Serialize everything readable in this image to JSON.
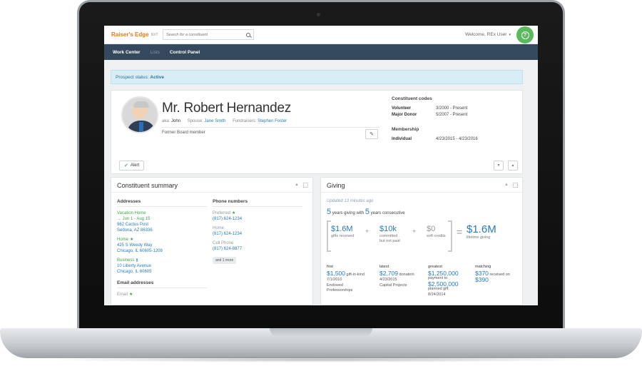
{
  "app": {
    "logo": "Raiser's Edge",
    "logo_suffix": "NXT",
    "search_placeholder": "Search for a constituent",
    "welcome": "Welcome, REx User",
    "help_icon": "?"
  },
  "nav": [
    "Work Center",
    "Lists",
    "Control Panel"
  ],
  "prospect": {
    "label": "Prospect status:",
    "value": "Active"
  },
  "profile": {
    "name": "Mr. Robert Hernandez",
    "aka_label": "aka:",
    "aka": "John",
    "spouse_label": "Spouse:",
    "spouse": "Jane Smith",
    "fundraisers_label": "Fundraisers:",
    "fundraisers": "Stephen Foster",
    "note": "Former Board member",
    "alert_label": "Alert"
  },
  "constituent_codes": {
    "title": "Constituent codes",
    "items": [
      {
        "code": "Volunteer",
        "dates": "3/2000 - Present"
      },
      {
        "code": "Major Donor",
        "dates": "5/2007 - Present"
      }
    ],
    "membership_title": "Membership",
    "membership": {
      "type": "Individual",
      "dates": "4/23/2015 - 4/23/2016"
    }
  },
  "summary": {
    "title": "Constituent summary",
    "addresses_title": "Addresses",
    "addresses": [
      {
        "type": "Vacation Home",
        "extra": "→ Jun 1 - Aug 15",
        "line1": "962 Cactus Post",
        "line2": "Sedona, AZ 86336"
      },
      {
        "type": "Home",
        "line1": "425 S Weedy Way",
        "line2": "Chicago, IL 60605-1208"
      },
      {
        "type": "Business",
        "line1": "10 Liberty Avenue",
        "line2": "Chicago, IL 60605"
      }
    ],
    "email_title": "Email addresses",
    "email_label": "Email",
    "phones_title": "Phone numbers",
    "phones": [
      {
        "type": "Preferred",
        "number": "(817) 624-1234"
      },
      {
        "type": "Home",
        "number": "(817) 624-1234"
      },
      {
        "type": "Cell Phone",
        "number": "(817) 624-8877"
      }
    ],
    "more": "and 1 more"
  },
  "giving": {
    "title": "Giving",
    "updated": "Updated 13 minutes ago",
    "years_giving": "5",
    "years_giving_text": "years giving with",
    "years_consecutive": "5",
    "years_consecutive_text": "years consecutive",
    "received_amt": "$1.6M",
    "received_label": "gifts received",
    "committed_amt": "$10k",
    "committed_label1": "committed",
    "committed_label2": "but not paid",
    "soft_amt": "$0",
    "soft_label": "soft credits",
    "lifetime_amt": "$1.6M",
    "lifetime_label": "lifetime giving",
    "stats": [
      {
        "head": "first",
        "amt": "$1,500",
        "desc": "gift-in-kind",
        "date": "7/1/2010",
        "extra1": "Endowed",
        "extra2": "Professorships"
      },
      {
        "head": "latest",
        "amt": "$2,709",
        "desc": "donation",
        "date": "4/23/2015",
        "extra1": "Capital Projects"
      },
      {
        "head": "greatest",
        "amt": "$1,250,000",
        "desc": "payment to",
        "amt2": "$2,500,000",
        "desc2": "planned gift",
        "date": "8/24/2014"
      },
      {
        "head": "matching",
        "amt": "$370",
        "desc": "received on",
        "amt2": "$390"
      }
    ]
  }
}
